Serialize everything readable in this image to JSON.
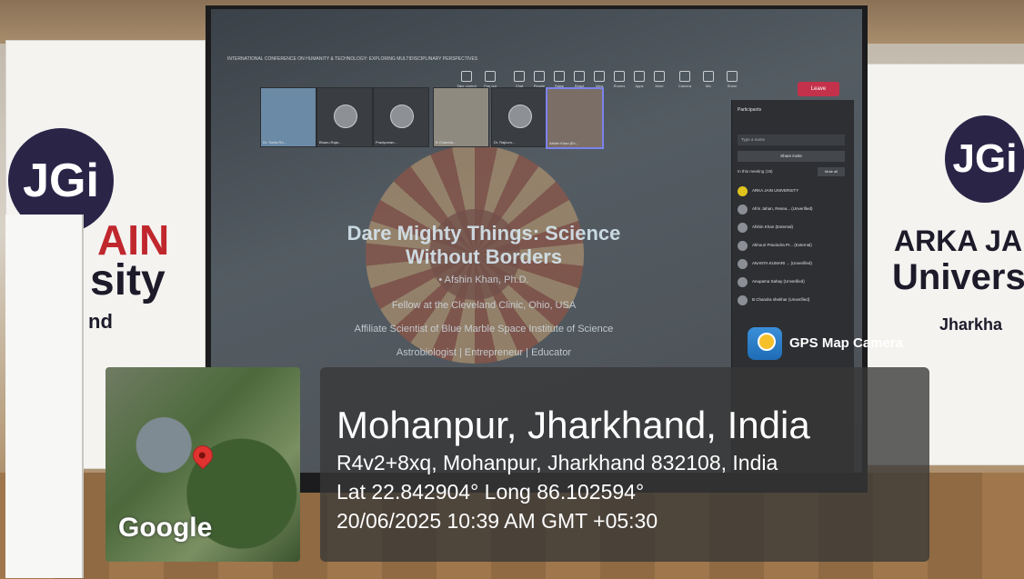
{
  "banners": {
    "left": {
      "logo": "JGi",
      "line1": "AIN",
      "line2": "sity",
      "line3": "nd"
    },
    "right": {
      "logo": "JGi",
      "line1": "ARKA JA",
      "line2": "Univers",
      "line3": "Jharkha"
    }
  },
  "screen": {
    "conference_title": "INTERNATIONAL CONFERENCE ON HUMANITY & TECHNOLOGY: EXPLORING MULTIDISCIPLINARY PERSPECTIVES",
    "toolbar": [
      "Take control",
      "Pop out",
      "Chat",
      "People",
      "Raise",
      "React",
      "View",
      "Rooms",
      "Apps",
      "More",
      "Camera",
      "Mic",
      "Share"
    ],
    "leave_label": "Leave",
    "tiles": [
      "Dr. Smita Ro...",
      "Bhanu Raja...",
      "Pradyuman...",
      "B Chandra...",
      "Dr. Rajkum...",
      "Afshin Khan (Ex..."
    ],
    "slide": {
      "title": "Dare Mighty Things: Science Without Borders",
      "author": "• Afshin Khan, Ph.D.",
      "line1": "Fellow at the Cleveland Clinic, Ohio, USA",
      "line2": "Affiliate Scientist of Blue Marble Space Institute of Science",
      "line3": "Astrobiologist | Entrepreneur | Educator"
    },
    "people_panel": {
      "heading": "Participants",
      "search_placeholder": "Type a name",
      "share_invite": "Share invite",
      "in_meeting": "In this meeting (19)",
      "mute_all": "Mute all",
      "participants": [
        "ARKA JAIN UNIVERSITY",
        "Afrin Jahan, Resea... (Unverified)",
        "Afshin Khan (External)",
        "Akhouri Pravindra Pr... (External)",
        "ANANTA KUMARI ... (Unverified)",
        "Anupama Sahay (Unverified)",
        "B Chandra shekhar (Unverified)"
      ]
    }
  },
  "gps": {
    "brand": "GPS Map Camera",
    "map_label": "Google",
    "location_title": "Mohanpur, Jharkhand, India",
    "address": "R4v2+8xq, Mohanpur, Jharkhand 832108, India",
    "coordinates": "Lat 22.842904° Long 86.102594°",
    "datetime": "20/06/2025 10:39 AM GMT +05:30"
  },
  "colors": {
    "leave": "#c4314b",
    "logo": "#2a2547",
    "banner_red": "#c0272d"
  }
}
